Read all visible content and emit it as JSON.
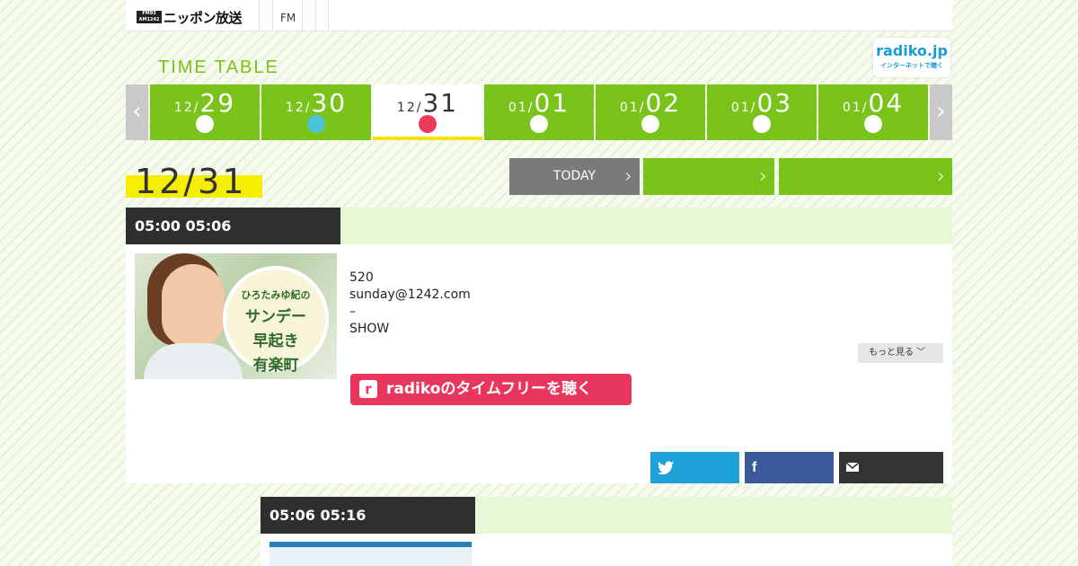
{
  "header": {
    "logo_mark": "FM93 AM1242",
    "logo_text": "ニッポン放送",
    "nav_fm": "FM"
  },
  "timetable": {
    "title": "TIME TABLE",
    "radiko_logo": "radiko.jp",
    "radiko_sub": "インターネットで聴く",
    "prev_arrow": "‹",
    "next_arrow": "›"
  },
  "dates": [
    {
      "month": "12/",
      "day": "29",
      "dot_color": "#ffffff"
    },
    {
      "month": "12/",
      "day": "30",
      "dot_color": "#4ec3d8"
    },
    {
      "month": "12/",
      "day": "31",
      "dot_color": "#ea3a5c",
      "active": true
    },
    {
      "month": "01/",
      "day": "01",
      "dot_color": "#ffffff"
    },
    {
      "month": "01/",
      "day": "02",
      "dot_color": "#ffffff"
    },
    {
      "month": "01/",
      "day": "03",
      "dot_color": "#ffffff"
    },
    {
      "month": "01/",
      "day": "04",
      "dot_color": "#ffffff"
    }
  ],
  "current_date": "12/31",
  "nav_buttons": {
    "today": "TODAY",
    "chev": "›"
  },
  "programs": [
    {
      "time": "05:00  05:06",
      "thumb_text_small": "ひろたみゆ紀の",
      "thumb_text_large_1": "サンデー",
      "thumb_text_large_2": "早起き",
      "thumb_text_large_3": "有楽町",
      "info_lines": [
        "520",
        "sunday@1242.com",
        "–",
        "SHOW"
      ],
      "more_label": "もっと見る ﹀",
      "radiko_label": "radikoのタイムフリーを聴く"
    },
    {
      "time": "05:06  05:16"
    }
  ],
  "colors": {
    "green": "#7ac31a",
    "dark": "#2f2f2f",
    "yellow": "#f6ee00",
    "radiko_red": "#e8365d",
    "twitter": "#1da1d6",
    "facebook": "#3b5998",
    "mail": "#333333"
  },
  "share": {
    "twitter_icon": "twitter-icon",
    "facebook_icon": "facebook-icon",
    "mail_icon": "mail-icon"
  }
}
